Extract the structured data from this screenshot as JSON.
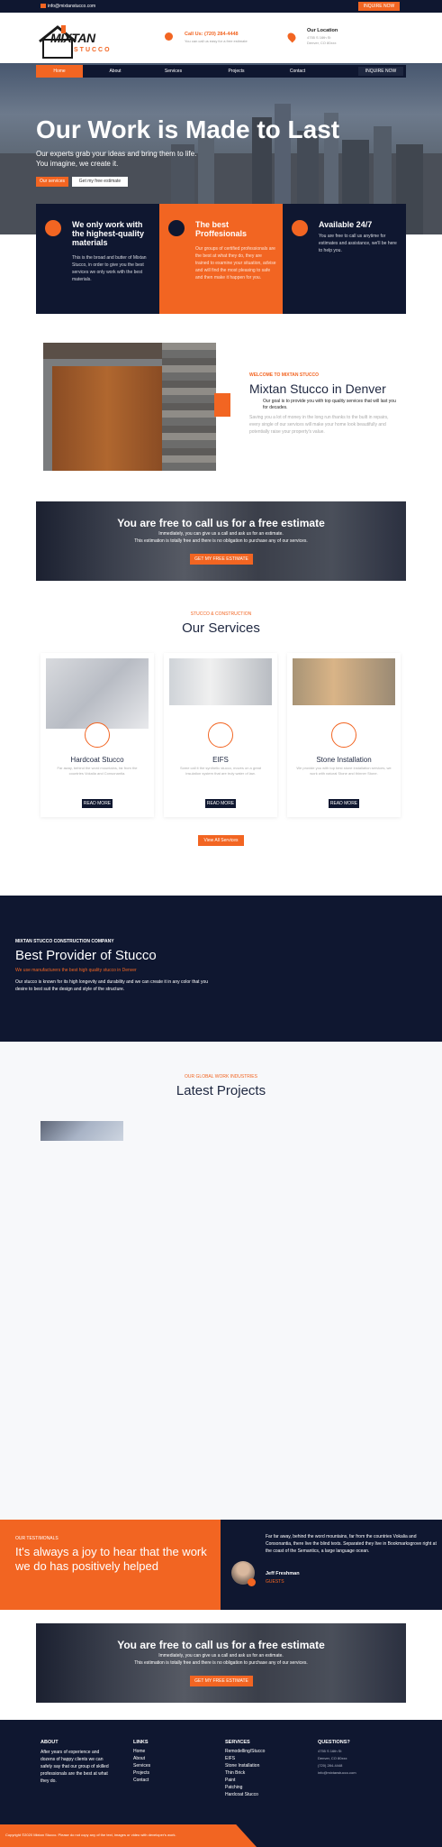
{
  "topbar": {
    "email": "info@mixtanstucco.com",
    "inquire": "INQUIRE NOW"
  },
  "header": {
    "logo_top": "MIXTAN",
    "logo_bottom": "STUCCO",
    "call_label": "Call Us: (720) 284-4448",
    "call_sub": "You can call us easy for a free estimate",
    "location_label": "Our Location",
    "location_line1": "4755 S 16th St",
    "location_line2": "Denver, CO 80xxx"
  },
  "nav": {
    "items": [
      "Home",
      "About",
      "Services",
      "Projects",
      "Contact"
    ],
    "inquire": "INQUIRE NOW"
  },
  "hero": {
    "title": "Our Work is Made to Last",
    "sub1": "Our experts grab your ideas and bring them to life.",
    "sub2": "You imagine, we create it.",
    "btn1": "Our services",
    "btn2": "Get my free estimate"
  },
  "features": [
    {
      "title": "We only work with the highest-quality materials",
      "text": "This is the broad and butter of Mixtan Stucco, in order to give you the best services we only work with the best materials."
    },
    {
      "title": "The best Proffesionals",
      "text": "Our groups of certified professionals are the best at what they do, they are trained to examine your situation, advise and will find the most pleasing to safe and then make it happen for you."
    },
    {
      "title": "Available 24/7",
      "text": "You are free to call us anytime for estimates and assistance, we'll be here to help you."
    }
  ],
  "welcome": {
    "kicker": "WELCOME TO MIXTAN STUCCO",
    "title": "Mixtan Stucco in Denver",
    "lead": "Our goal is to provide you with top quality services that will last you for decades.",
    "text": "Saving you a lot of money in the long run thanks to the built in repairs, every single of our services will make your home look beautifully and potentially raise your property's value."
  },
  "cta": {
    "title": "You are free to call us for a free estimate",
    "line1": "Immediately, you can give us a call and ask us for an estimate.",
    "line2": "This estimation is totally free and there is no obligation to purchase any of our services.",
    "btn": "GET MY FREE ESTIMATE"
  },
  "services": {
    "kicker": "STUCCO & CONSTRUCTION",
    "title": "Our Services",
    "items": [
      {
        "name": "Hardcoat Stucco",
        "text": "Far away, behind the word mountains, far from the countries Vokalia and Consonantia.",
        "btn": "READ MORE"
      },
      {
        "name": "EIFS",
        "text": "Some call it the synthetic stucco, moves on a great insulation system that are truly water of law.",
        "btn": "READ MORE"
      },
      {
        "name": "Stone Installation",
        "text": "We provide you with top best stone installation services, we work with natural Stone and thinner Stone.",
        "btn": "READ MORE"
      }
    ],
    "view_all": "View All Services"
  },
  "provider": {
    "kicker": "MIXTAN STUCCO CONSTRUCTION COMPANY",
    "title": "Best Provider of Stucco",
    "sub": "We use manufacturers the best high quality stucco in Denver",
    "text": "Our stucco is known for its high longevity and durability and we can create it in any color that you desire to best suit the design and style of the structure."
  },
  "projects": {
    "kicker": "OUR GLOBAL WORK INDUSTRIES",
    "title": "Latest Projects"
  },
  "testimonial": {
    "kicker": "OUR TESTIMONALS",
    "title": "It's always a joy to hear that the work we do has positively helped",
    "quote": "Far far away, behind the word mountains, far from the countries Vokalia and Consonantia, there live the blind texts. Separated they live in Bookmarksgrove right at the coast of the Semantics, a large language ocean.",
    "name": "Jeff Freshman",
    "role": "GUESTS"
  },
  "footer": {
    "about_title": "ABOUT",
    "about_text": "After years of experience and dozens of happy clients we can safely say that our group of skilled professionals are the best at what they do.",
    "links_title": "LINKS",
    "links": [
      "Home",
      "About",
      "Services",
      "Projects",
      "Contact"
    ],
    "services_title": "SERVICES",
    "services": [
      "Remodelling/Stucco",
      "EIFS",
      "Stone Installation",
      "Thin Brick",
      "Paint",
      "Patching",
      "Hardcoat Stucco"
    ],
    "questions_title": "QUESTIONS?",
    "questions": [
      "4755 S 16th St",
      "Denver, CO 80xxx",
      "(720) 284-4448",
      "info@mixtanstucco.com"
    ],
    "copyright": "Copyright ©2020 Mixtan Stucco. Please do not copy any of the text, images or video with developer's work."
  },
  "colors": {
    "navy": "#0f1730",
    "orange": "#f26522"
  }
}
